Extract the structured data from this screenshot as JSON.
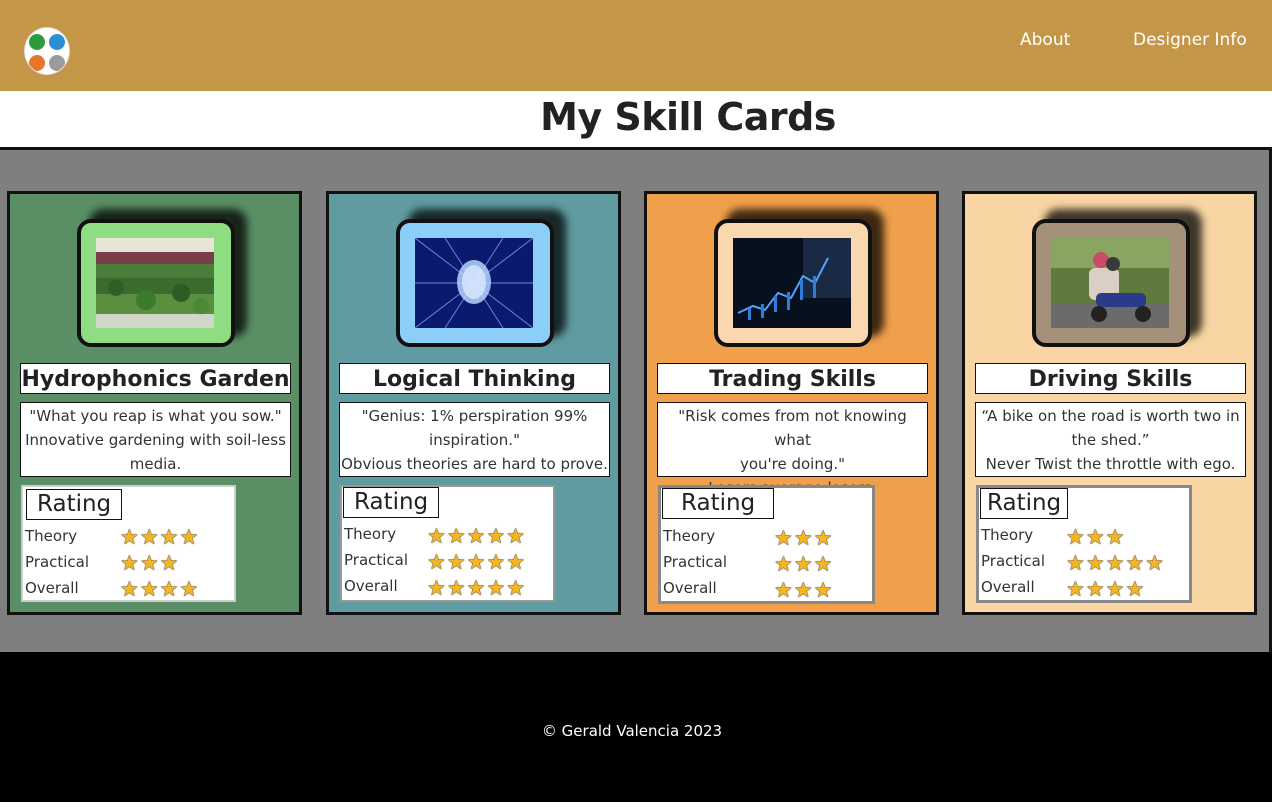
{
  "nav": {
    "links": [
      "About",
      "Designer Info"
    ]
  },
  "page_title": "My Skill Cards",
  "cards": [
    {
      "name": "Hydrophonics Garden",
      "quote_lines": [
        "\"What you reap is what you sow.\"",
        "Innovative gardening with soil-less",
        "media."
      ],
      "bg": "#5a8f65",
      "frame": "#8fdd82",
      "ratings": [
        {
          "label": "Theory",
          "stars": 4
        },
        {
          "label": "Practical",
          "stars": 3
        },
        {
          "label": "Overall",
          "stars": 4
        }
      ]
    },
    {
      "name": "Logical Thinking",
      "quote_lines": [
        "\"Genius: 1% perspiration 99%",
        "inspiration.\"",
        "Obvious theories are hard to prove."
      ],
      "bg": "#5f9ba0",
      "frame": "#8bcff8",
      "ratings": [
        {
          "label": "Theory",
          "stars": 5
        },
        {
          "label": "Practical",
          "stars": 5
        },
        {
          "label": "Overall",
          "stars": 5
        }
      ]
    },
    {
      "name": "Trading Skills",
      "quote_lines": [
        "\"Risk comes from not knowing what",
        "you're doing.\"",
        "Losers average losers."
      ],
      "bg": "#f0a04b",
      "frame": "#fbd7b0",
      "ratings": [
        {
          "label": "Theory",
          "stars": 3
        },
        {
          "label": "Practical",
          "stars": 3
        },
        {
          "label": "Overall",
          "stars": 3
        }
      ]
    },
    {
      "name": "Driving Skills",
      "quote_lines": [
        "“A bike on the road is worth two in",
        "the shed.”",
        "Never Twist the throttle with ego."
      ],
      "bg": "#f8d5a3",
      "frame": "#a5907a",
      "ratings": [
        {
          "label": "Theory",
          "stars": 3
        },
        {
          "label": "Practical",
          "stars": 5
        },
        {
          "label": "Overall",
          "stars": 4
        }
      ]
    }
  ],
  "rating_title": "Rating",
  "footer_text": "© Gerald Valencia 2023",
  "colors": {
    "navbar": "#c49748",
    "cards_background": "#7f7f7f",
    "footer": "#000000",
    "star": "#f5b623"
  }
}
